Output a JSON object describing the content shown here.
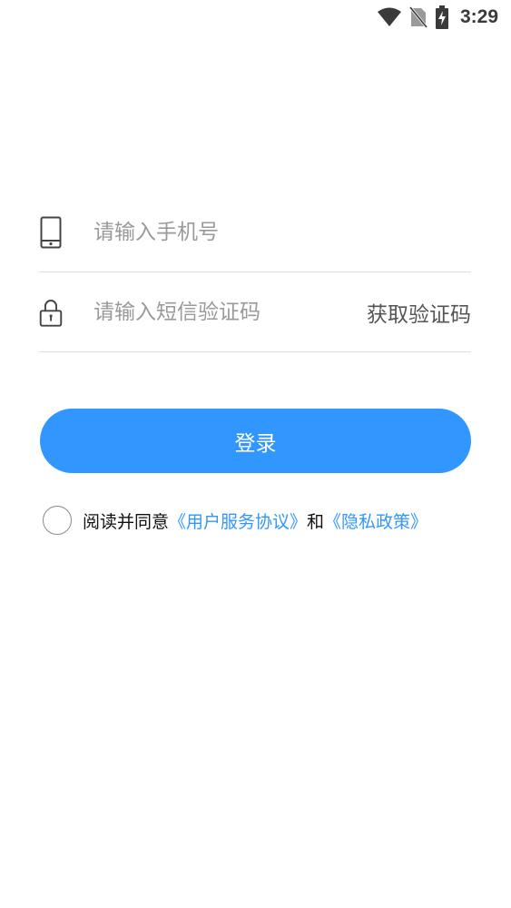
{
  "status_bar": {
    "time": "3:29",
    "icons": [
      "wifi-icon",
      "no-sim-icon",
      "battery-charging-icon"
    ]
  },
  "form": {
    "phone_placeholder": "请输入手机号",
    "code_placeholder": "请输入短信验证码",
    "get_code_label": "获取验证码"
  },
  "login": {
    "label": "登录"
  },
  "agreement": {
    "prefix": "阅读并同意",
    "user_agreement": "《用户服务协议》",
    "conjunction": "和",
    "privacy_policy": "《隐私政策》",
    "checked": false
  },
  "colors": {
    "accent": "#3197ff",
    "divider": "#dcdcdc",
    "placeholder": "#9a9a9a"
  }
}
